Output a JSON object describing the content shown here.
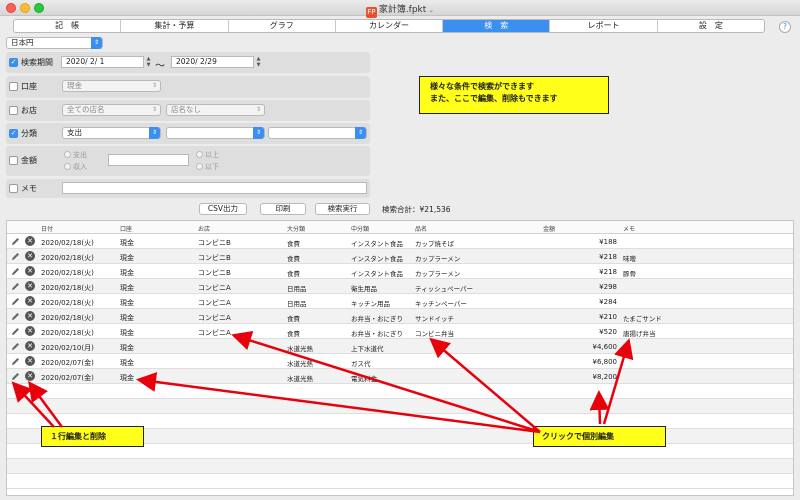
{
  "window": {
    "title": "家計簿.fpkt",
    "app_icon_glyph": "FP",
    "title_chevron": "⌄"
  },
  "tabs": [
    "記　帳",
    "集計・予算",
    "グラフ",
    "カレンダー",
    "検　索",
    "レポート",
    "設　定"
  ],
  "active_tab": "検　索",
  "help_label": "?",
  "currency": "日本円",
  "filters": {
    "period": {
      "label": "検索期間",
      "checked": true,
      "from": "2020/ 2/ 1",
      "separator": "〜",
      "to": "2020/ 2/29"
    },
    "account": {
      "label": "口座",
      "checked": false,
      "value": "現金"
    },
    "shop": {
      "label": "お店",
      "checked": false,
      "value": "全ての店名",
      "value2": "店名なし"
    },
    "category": {
      "label": "分類",
      "checked": true,
      "value": "支出"
    },
    "amount": {
      "label": "金額",
      "checked": false,
      "radio_expense": "支出",
      "radio_income": "収入",
      "radio_over": "以上",
      "radio_under": "以下"
    },
    "memo": {
      "label": "メモ",
      "checked": false
    }
  },
  "buttons": {
    "csv": "CSV出力",
    "print": "印刷",
    "search": "検索実行"
  },
  "total": "検索合計：¥21,536",
  "callouts": {
    "top_line1": "様々な条件で検索ができます",
    "top_line2": "また、ここで編集、削除もできます",
    "bottom_left": "１行編集と削除",
    "bottom_right": "クリックで個別編集"
  },
  "table": {
    "headers": [
      "日付",
      "口座",
      "お店",
      "大分類",
      "中分類",
      "品名",
      "金額",
      "メモ"
    ],
    "rows": [
      {
        "date": "2020/02/18(火)",
        "account": "現金",
        "shop": "コンビニB",
        "cat": "食費",
        "sub": "インスタント食品",
        "item": "カップ焼そば",
        "amount": "¥188",
        "memo": ""
      },
      {
        "date": "2020/02/18(火)",
        "account": "現金",
        "shop": "コンビニB",
        "cat": "食費",
        "sub": "インスタント食品",
        "item": "カップラーメン",
        "amount": "¥218",
        "memo": "味噌"
      },
      {
        "date": "2020/02/18(火)",
        "account": "現金",
        "shop": "コンビニB",
        "cat": "食費",
        "sub": "インスタント食品",
        "item": "カップラーメン",
        "amount": "¥218",
        "memo": "豚骨"
      },
      {
        "date": "2020/02/18(火)",
        "account": "現金",
        "shop": "コンビニA",
        "cat": "日用品",
        "sub": "衛生用品",
        "item": "ティッシュペーパー",
        "amount": "¥298",
        "memo": ""
      },
      {
        "date": "2020/02/18(火)",
        "account": "現金",
        "shop": "コンビニA",
        "cat": "日用品",
        "sub": "キッチン用品",
        "item": "キッチンペーパー",
        "amount": "¥284",
        "memo": ""
      },
      {
        "date": "2020/02/18(火)",
        "account": "現金",
        "shop": "コンビニA",
        "cat": "食費",
        "sub": "お弁当・おにぎり",
        "item": "サンドイッチ",
        "amount": "¥210",
        "memo": "たまごサンド"
      },
      {
        "date": "2020/02/18(火)",
        "account": "現金",
        "shop": "コンビニA",
        "cat": "食費",
        "sub": "お弁当・おにぎり",
        "item": "コンビニ弁当",
        "amount": "¥520",
        "memo": "唐揚げ弁当"
      },
      {
        "date": "2020/02/10(月)",
        "account": "現金",
        "shop": "",
        "cat": "水道光熱",
        "sub": "上下水道代",
        "item": "",
        "amount": "¥4,600",
        "memo": ""
      },
      {
        "date": "2020/02/07(金)",
        "account": "現金",
        "shop": "",
        "cat": "水道光熱",
        "sub": "ガス代",
        "item": "",
        "amount": "¥6,800",
        "memo": ""
      },
      {
        "date": "2020/02/07(金)",
        "account": "現金",
        "shop": "",
        "cat": "水道光熱",
        "sub": "電気料金",
        "item": "",
        "amount": "¥8,200",
        "memo": ""
      }
    ]
  },
  "colors": {
    "accent": "#3a8ff1",
    "callout_bg": "#ffff1a",
    "arrow": "#e8000b"
  }
}
